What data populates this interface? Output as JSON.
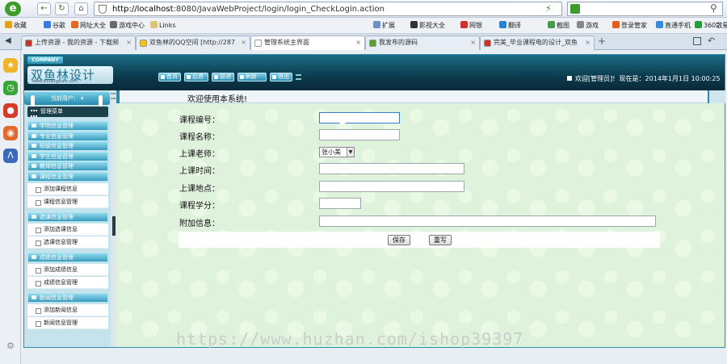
{
  "browser": {
    "url_host": "http://localhost",
    "url_rest": ":8080/JavaWebProject/login/login_CheckLogin.action",
    "bookmarks": [
      {
        "label": "收藏",
        "color": "#e3a21a"
      },
      {
        "label": "谷歌",
        "color": "#3a7be0"
      },
      {
        "label": "网址大全",
        "color": "#e0692a"
      },
      {
        "label": "游戏中心",
        "color": "#6a6a6a"
      },
      {
        "label": "Links",
        "color": "#d9c47a"
      }
    ],
    "toolbar_right": [
      {
        "label": "扩展",
        "color": "#6c8fc8"
      },
      {
        "label": "影视大全",
        "color": "#333"
      },
      {
        "label": "网银",
        "color": "#d03030"
      },
      {
        "label": "翻译",
        "color": "#2a7fd0"
      },
      {
        "label": "截图",
        "color": "#4a9a4a"
      },
      {
        "label": "游戏",
        "color": "#888"
      },
      {
        "label": "登录管家",
        "color": "#e06020"
      },
      {
        "label": "直通手机",
        "color": "#3a8adc"
      },
      {
        "label": "360散星日",
        "color": "#2a9a3a"
      }
    ],
    "tabs": [
      {
        "label": "上传资源 - 我的资源 - 下载频",
        "color": "#c0392b",
        "active": false
      },
      {
        "label": "双鱼林的QQ空间 [http://287",
        "color": "#f0c419",
        "active": false
      },
      {
        "label": "管理系统主界面",
        "color": "#ffffff",
        "active": true
      },
      {
        "label": "我发布的源码",
        "color": "#5aa02c",
        "active": false
      },
      {
        "label": "完美_毕业课程电的设计_双鱼",
        "color": "#c0392b",
        "active": false
      }
    ]
  },
  "header": {
    "company_tag": "COMPANY",
    "logo_text": "双鱼林设计",
    "logo_url": "www.shuangyulin.com",
    "nav": [
      "首页",
      "后退",
      "前进",
      "刷新",
      "退出"
    ],
    "welcome": "欢迎[管理员]!",
    "date_text": "现在是：2014年1月1日 10:00:25"
  },
  "sidebar": {
    "user_label": "当前用户：",
    "menu_title": "管理菜单",
    "groups": [
      {
        "label": "学院信息管理",
        "items": []
      },
      {
        "label": "专业信息管理",
        "items": []
      },
      {
        "label": "班级信息管理",
        "items": []
      },
      {
        "label": "学生信息管理",
        "items": []
      },
      {
        "label": "教师信息管理",
        "items": []
      },
      {
        "label": "课程信息管理",
        "items": [
          "添加课程信息",
          "课程信息管理"
        ]
      },
      {
        "label": "选课信息管理",
        "items": [
          "添加选课信息",
          "选课信息管理"
        ]
      },
      {
        "label": "成绩信息管理",
        "items": [
          "添加成绩信息",
          "成绩信息管理"
        ]
      },
      {
        "label": "新闻信息管理",
        "items": [
          "添加新闻信息",
          "新闻信息管理"
        ]
      }
    ]
  },
  "form": {
    "title": "欢迎使用本系统!",
    "fields": [
      {
        "label": "课程编号：",
        "value": ""
      },
      {
        "label": "课程名称：",
        "value": ""
      },
      {
        "label": "上课老师：",
        "value": "张小美"
      },
      {
        "label": "上课时间：",
        "value": ""
      },
      {
        "label": "上课地点：",
        "value": ""
      },
      {
        "label": "课程学分：",
        "value": ""
      },
      {
        "label": "附加信息：",
        "value": ""
      }
    ],
    "save_label": "保存",
    "reset_label": "重写"
  },
  "watermark": "https://www.huzhan.com/ishop39397"
}
